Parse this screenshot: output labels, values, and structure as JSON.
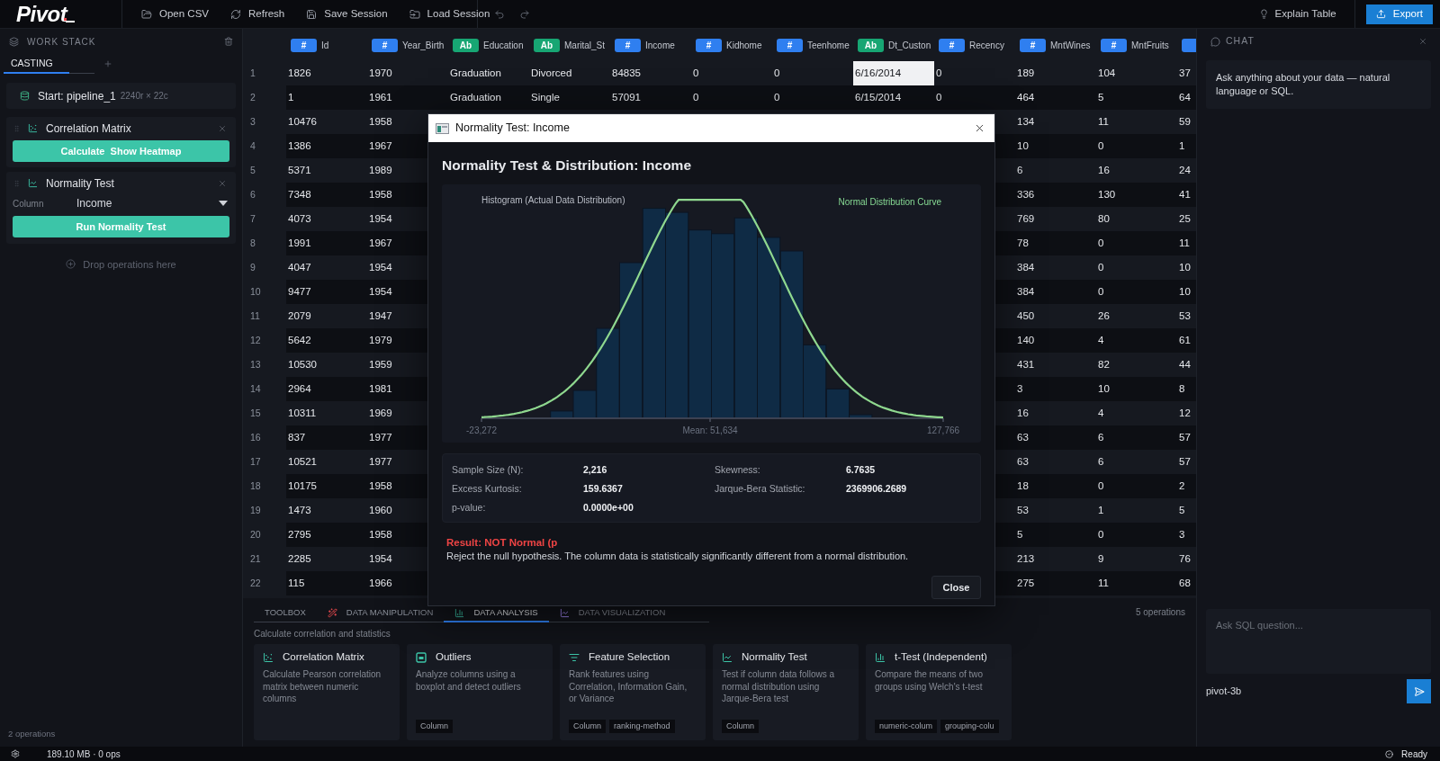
{
  "top_bar": {
    "logo": "Pivot",
    "actions": [
      {
        "label": "Open CSV"
      },
      {
        "label": "Refresh"
      },
      {
        "label": "Save Session"
      },
      {
        "label": "Load Session"
      }
    ],
    "explain": "Explain Table",
    "export": "Export"
  },
  "work_stack": {
    "title": "WORK STACK",
    "tabs": [
      {
        "label": "CASTING",
        "selected": true
      }
    ],
    "source": {
      "name": "Start: pipeline_1",
      "size": "2240r × 22c"
    },
    "operations": [
      {
        "kind": "action",
        "title": "Correlation Matrix",
        "button": "Calculate  Show Heatmap"
      },
      {
        "kind": "column_select",
        "title": "Normality Test",
        "field_label": "Column",
        "field_value": "Income",
        "button": "Run Normality Test"
      }
    ],
    "drop_hint": "Drop operations here",
    "footer": "2 operations"
  },
  "table": {
    "columns": [
      {
        "kind": "number",
        "badge": "#",
        "name": "Id"
      },
      {
        "kind": "number",
        "badge": "#",
        "name": "Year_Birth"
      },
      {
        "kind": "text",
        "badge": "Ab",
        "name": "Education"
      },
      {
        "kind": "text",
        "badge": "Ab",
        "name": "Marital_St"
      },
      {
        "kind": "number",
        "badge": "#",
        "name": "Income"
      },
      {
        "kind": "number",
        "badge": "#",
        "name": "Kidhome"
      },
      {
        "kind": "number",
        "badge": "#",
        "name": "Teenhome"
      },
      {
        "kind": "text",
        "badge": "Ab",
        "name": "Dt_Custon"
      },
      {
        "kind": "number",
        "badge": "#",
        "name": "Recency"
      },
      {
        "kind": "number",
        "badge": "#",
        "name": "MntWines"
      },
      {
        "kind": "number",
        "badge": "#",
        "name": "MntFruits"
      },
      {
        "kind": "number"
      }
    ],
    "rows": [
      {
        "number": "1",
        "cells": [
          {
            "text": "1826",
            "selected": false
          },
          {
            "text": "1970",
            "selected": false
          },
          {
            "text": "Graduation",
            "selected": false
          },
          {
            "text": "Divorced",
            "selected": false
          },
          {
            "text": "84835",
            "selected": false
          },
          {
            "text": "0",
            "selected": false
          },
          {
            "text": "0",
            "selected": false
          },
          {
            "text": "6/16/2014",
            "selected": true
          },
          {
            "text": "0",
            "selected": false
          },
          {
            "text": "189",
            "selected": false
          },
          {
            "text": "104",
            "selected": false
          },
          {
            "text": "37",
            "selected": false
          }
        ]
      },
      {
        "number": "2",
        "cells": [
          {
            "text": "1",
            "selected": false
          },
          {
            "text": "1961",
            "selected": false
          },
          {
            "text": "Graduation",
            "selected": false
          },
          {
            "text": "Single",
            "selected": false
          },
          {
            "text": "57091",
            "selected": false
          },
          {
            "text": "0",
            "selected": false
          },
          {
            "text": "0",
            "selected": false
          },
          {
            "text": "6/15/2014",
            "selected": false
          },
          {
            "text": "0",
            "selected": false
          },
          {
            "text": "464",
            "selected": false
          },
          {
            "text": "5",
            "selected": false
          },
          {
            "text": "64",
            "selected": false
          }
        ]
      },
      {
        "number": "3",
        "cells": [
          {
            "text": "10476",
            "selected": false
          },
          {
            "text": "1958",
            "selected": false
          },
          null,
          null,
          null,
          null,
          null,
          null,
          null,
          {
            "text": "134",
            "selected": false
          },
          {
            "text": "11",
            "selected": false
          },
          {
            "text": "59",
            "selected": false
          }
        ]
      },
      {
        "number": "4",
        "cells": [
          {
            "text": "1386",
            "selected": false
          },
          {
            "text": "1967",
            "selected": false
          },
          null,
          null,
          null,
          null,
          null,
          null,
          null,
          {
            "text": "10",
            "selected": false
          },
          {
            "text": "0",
            "selected": false
          },
          {
            "text": "1",
            "selected": false
          }
        ]
      },
      {
        "number": "5",
        "cells": [
          {
            "text": "5371",
            "selected": false
          },
          {
            "text": "1989",
            "selected": false
          },
          null,
          null,
          null,
          null,
          null,
          null,
          null,
          {
            "text": "6",
            "selected": false
          },
          {
            "text": "16",
            "selected": false
          },
          {
            "text": "24",
            "selected": false
          }
        ]
      },
      {
        "number": "6",
        "cells": [
          {
            "text": "7348",
            "selected": false
          },
          {
            "text": "1958",
            "selected": false
          },
          null,
          null,
          null,
          null,
          null,
          null,
          null,
          {
            "text": "336",
            "selected": false
          },
          {
            "text": "130",
            "selected": false
          },
          {
            "text": "41",
            "selected": false
          }
        ]
      },
      {
        "number": "7",
        "cells": [
          {
            "text": "4073",
            "selected": false
          },
          {
            "text": "1954",
            "selected": false
          },
          null,
          null,
          null,
          null,
          null,
          null,
          null,
          {
            "text": "769",
            "selected": false
          },
          {
            "text": "80",
            "selected": false
          },
          {
            "text": "25",
            "selected": false
          }
        ]
      },
      {
        "number": "8",
        "cells": [
          {
            "text": "1991",
            "selected": false
          },
          {
            "text": "1967",
            "selected": false
          },
          null,
          null,
          null,
          null,
          null,
          null,
          null,
          {
            "text": "78",
            "selected": false
          },
          {
            "text": "0",
            "selected": false
          },
          {
            "text": "11",
            "selected": false
          }
        ]
      },
      {
        "number": "9",
        "cells": [
          {
            "text": "4047",
            "selected": false
          },
          {
            "text": "1954",
            "selected": false
          },
          null,
          null,
          null,
          null,
          null,
          null,
          null,
          {
            "text": "384",
            "selected": false
          },
          {
            "text": "0",
            "selected": false
          },
          {
            "text": "10",
            "selected": false
          }
        ]
      },
      {
        "number": "10",
        "cells": [
          {
            "text": "9477",
            "selected": false
          },
          {
            "text": "1954",
            "selected": false
          },
          null,
          null,
          null,
          null,
          null,
          null,
          null,
          {
            "text": "384",
            "selected": false
          },
          {
            "text": "0",
            "selected": false
          },
          {
            "text": "10",
            "selected": false
          }
        ]
      },
      {
        "number": "11",
        "cells": [
          {
            "text": "2079",
            "selected": false
          },
          {
            "text": "1947",
            "selected": false
          },
          null,
          null,
          null,
          null,
          null,
          null,
          null,
          {
            "text": "450",
            "selected": false
          },
          {
            "text": "26",
            "selected": false
          },
          {
            "text": "53",
            "selected": false
          }
        ]
      },
      {
        "number": "12",
        "cells": [
          {
            "text": "5642",
            "selected": false
          },
          {
            "text": "1979",
            "selected": false
          },
          null,
          null,
          null,
          null,
          null,
          null,
          null,
          {
            "text": "140",
            "selected": false
          },
          {
            "text": "4",
            "selected": false
          },
          {
            "text": "61",
            "selected": false
          }
        ]
      },
      {
        "number": "13",
        "cells": [
          {
            "text": "10530",
            "selected": false
          },
          {
            "text": "1959",
            "selected": false
          },
          null,
          null,
          null,
          null,
          null,
          null,
          null,
          {
            "text": "431",
            "selected": false
          },
          {
            "text": "82",
            "selected": false
          },
          {
            "text": "44",
            "selected": false
          }
        ]
      },
      {
        "number": "14",
        "cells": [
          {
            "text": "2964",
            "selected": false
          },
          {
            "text": "1981",
            "selected": false
          },
          null,
          null,
          null,
          null,
          null,
          null,
          null,
          {
            "text": "3",
            "selected": false
          },
          {
            "text": "10",
            "selected": false
          },
          {
            "text": "8",
            "selected": false
          }
        ]
      },
      {
        "number": "15",
        "cells": [
          {
            "text": "10311",
            "selected": false
          },
          {
            "text": "1969",
            "selected": false
          },
          null,
          null,
          null,
          null,
          null,
          null,
          null,
          {
            "text": "16",
            "selected": false
          },
          {
            "text": "4",
            "selected": false
          },
          {
            "text": "12",
            "selected": false
          }
        ]
      },
      {
        "number": "16",
        "cells": [
          {
            "text": "837",
            "selected": false
          },
          {
            "text": "1977",
            "selected": false
          },
          null,
          null,
          null,
          null,
          null,
          null,
          null,
          {
            "text": "63",
            "selected": false
          },
          {
            "text": "6",
            "selected": false
          },
          {
            "text": "57",
            "selected": false
          }
        ]
      },
      {
        "number": "17",
        "cells": [
          {
            "text": "10521",
            "selected": false
          },
          {
            "text": "1977",
            "selected": false
          },
          null,
          null,
          null,
          null,
          null,
          null,
          null,
          {
            "text": "63",
            "selected": false
          },
          {
            "text": "6",
            "selected": false
          },
          {
            "text": "57",
            "selected": false
          }
        ]
      },
      {
        "number": "18",
        "cells": [
          {
            "text": "10175",
            "selected": false
          },
          {
            "text": "1958",
            "selected": false
          },
          null,
          null,
          null,
          null,
          null,
          null,
          null,
          {
            "text": "18",
            "selected": false
          },
          {
            "text": "0",
            "selected": false
          },
          {
            "text": "2",
            "selected": false
          }
        ]
      },
      {
        "number": "19",
        "cells": [
          {
            "text": "1473",
            "selected": false
          },
          {
            "text": "1960",
            "selected": false
          },
          null,
          null,
          null,
          null,
          null,
          null,
          null,
          {
            "text": "53",
            "selected": false
          },
          {
            "text": "1",
            "selected": false
          },
          {
            "text": "5",
            "selected": false
          }
        ]
      },
      {
        "number": "20",
        "cells": [
          {
            "text": "2795",
            "selected": false
          },
          {
            "text": "1958",
            "selected": false
          },
          null,
          null,
          null,
          null,
          null,
          null,
          null,
          {
            "text": "5",
            "selected": false
          },
          {
            "text": "0",
            "selected": false
          },
          {
            "text": "3",
            "selected": false
          }
        ]
      },
      {
        "number": "21",
        "cells": [
          {
            "text": "2285",
            "selected": false
          },
          {
            "text": "1954",
            "selected": false
          },
          null,
          null,
          null,
          null,
          null,
          null,
          null,
          {
            "text": "213",
            "selected": false
          },
          {
            "text": "9",
            "selected": false
          },
          {
            "text": "76",
            "selected": false
          }
        ]
      },
      {
        "number": "22",
        "cells": [
          {
            "text": "115",
            "selected": false
          },
          {
            "text": "1966",
            "selected": false
          },
          null,
          null,
          null,
          null,
          null,
          null,
          null,
          {
            "text": "275",
            "selected": false
          },
          {
            "text": "11",
            "selected": false
          },
          {
            "text": "68",
            "selected": false
          }
        ]
      }
    ]
  },
  "toolbox": {
    "title": "TOOLBOX",
    "tabs": [
      {
        "label": "DATA MANIPULATION",
        "selected": false
      },
      {
        "label": "DATA ANALYSIS",
        "selected": true
      },
      {
        "label": "DATA VISUALIZATION",
        "selected": false
      }
    ],
    "count": "5 operations",
    "description": "Calculate correlation and statistics",
    "cards": [
      {
        "title": "Correlation Matrix",
        "description": "Calculate Pearson correlation matrix between numeric columns"
      },
      {
        "title": "Outliers",
        "description": "Analyze columns using a boxplot and detect outliers",
        "tags": [
          "Column"
        ]
      },
      {
        "title": "Feature Selection",
        "description": "Rank features using Correlation, Information Gain, or Variance",
        "tags": [
          "Column",
          "ranking-method"
        ]
      },
      {
        "title": "Normality Test",
        "description": "Test if column data follows a normal distribution using Jarque-Bera test",
        "tags": [
          "Column"
        ]
      },
      {
        "title": "t-Test (Independent)",
        "description": "Compare the means of two groups using Welch's t-test",
        "tags": [
          "numeric-colum",
          "grouping-colu"
        ]
      }
    ]
  },
  "chat": {
    "title": "CHAT",
    "message": "Ask anything about your data — natural language or SQL.",
    "placeholder": "Ask SQL question...",
    "model": "pivot-3b"
  },
  "status_bar": {
    "memory": "189.10 MB · 0 ops",
    "status": "Ready"
  },
  "dialog": {
    "window_title": "Normality Test: Income",
    "heading": "Normality Test & Distribution: Income",
    "chart": {
      "title": "Histogram (Actual Data Distribution)",
      "legend": "Normal Distribution Curve",
      "x_min": "-23,272",
      "x_mid": "Mean: 51,634",
      "x_max": "127,766"
    },
    "stats": [
      {
        "label": "Sample Size (N):",
        "value": "2,216"
      },
      {
        "label": "Skewness:",
        "value": "6.7635"
      },
      {
        "label": "Excess Kurtosis:",
        "value": "159.6367"
      },
      {
        "label": "Jarque-Bera Statistic:",
        "value": "2369906.2689"
      },
      {
        "label": "p-value:",
        "value": "0.0000e+00"
      }
    ],
    "verdict": "Result: NOT Normal (p",
    "explanation": "Reject the null hypothesis. The column data is statistically significantly different from a normal distribution.",
    "close_button": "Close"
  }
}
